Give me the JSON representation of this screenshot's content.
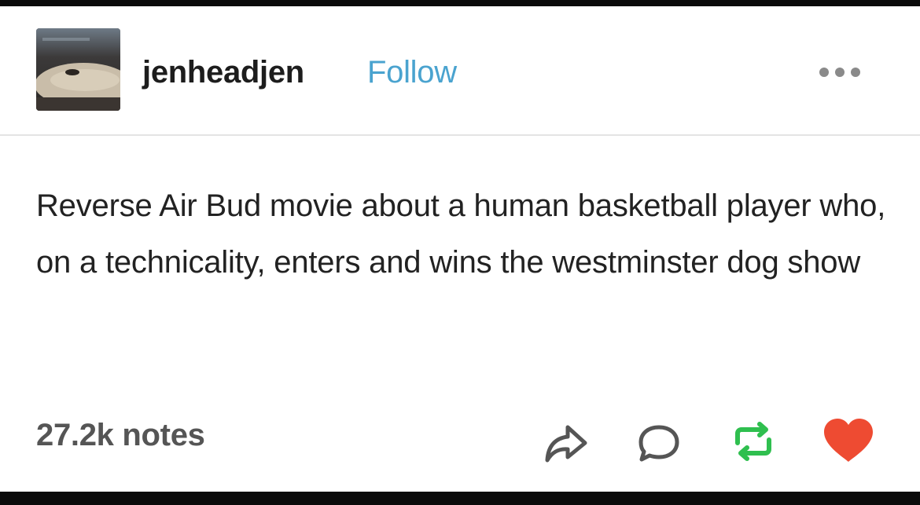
{
  "post": {
    "username": "jenheadjen",
    "follow_label": "Follow",
    "body": "Reverse Air Bud movie about a human basketball player who, on a technicality, enters and wins the westminster dog show",
    "notes": "27.2k notes"
  },
  "icons": {
    "more": "ellipsis-icon",
    "share": "share-icon",
    "reply": "reply-icon",
    "reblog": "reblog-icon",
    "like": "heart-icon"
  },
  "colors": {
    "follow": "#4aa3cf",
    "reblog": "#2fbf4f",
    "like": "#ee4b32"
  }
}
